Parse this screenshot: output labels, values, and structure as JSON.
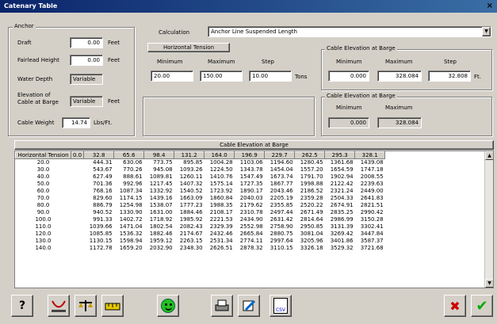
{
  "window": {
    "title": "Catenary Table",
    "close": "×"
  },
  "anchor": {
    "group": "Anchor",
    "draft_label": "Draft",
    "draft_value": "0.00",
    "draft_unit": "Feet",
    "fairlead_label": "Fairlead Height",
    "fairlead_value": "0.00",
    "fairlead_unit": "Feet",
    "water_label": "Water Depth",
    "water_value": "Variable",
    "elev_label1": "Elevation of",
    "elev_label2": "Cable at Barge",
    "elev_value": "Variable",
    "elev_unit": "Feet",
    "weight_label": "Cable Weight",
    "weight_value": "14.74",
    "weight_unit": "Lbs/Ft."
  },
  "calculation": {
    "label": "Calculation",
    "value": "Anchor Line Suspended Length"
  },
  "tension": {
    "button": "Horizontal Tension",
    "min_label": "Minimum",
    "max_label": "Maximum",
    "step_label": "Step",
    "min": "20.00",
    "max": "150.00",
    "step": "10.00",
    "unit": "Tons"
  },
  "elev1": {
    "group": "Cable Elevation at Barge",
    "min_label": "Minimum",
    "max_label": "Maximum",
    "step_label": "Step",
    "min": "0.000",
    "max": "328.084",
    "step": "32.808",
    "unit": "Ft."
  },
  "elev2": {
    "group": "Cable Elevation at Barge",
    "min_label": "Minimum",
    "max_label": "Maximum",
    "min": "0.000",
    "max": "328.084"
  },
  "table": {
    "caption": "Cable Elevation at Barge",
    "headers": [
      "Horizontal Tension",
      "0.0",
      "32.8",
      "65.6",
      "98.4",
      "131.2",
      "164.0",
      "196.9",
      "229.7",
      "262.5",
      "295.3",
      "328.1"
    ],
    "rows": [
      [
        "20.0",
        "",
        "444.31",
        "630.06",
        "773.75",
        "895.85",
        "1004.28",
        "1103.06",
        "1194.60",
        "1280.45",
        "1361.68",
        "1439.08"
      ],
      [
        "30.0",
        "",
        "543.67",
        "770.26",
        "945.08",
        "1093.26",
        "1224.50",
        "1343.78",
        "1454.04",
        "1557.20",
        "1654.59",
        "1747.18"
      ],
      [
        "40.0",
        "",
        "627.49",
        "888.61",
        "1089.81",
        "1260.11",
        "1410.76",
        "1547.49",
        "1673.74",
        "1791.70",
        "1902.94",
        "2008.55"
      ],
      [
        "50.0",
        "",
        "701.36",
        "992.96",
        "1217.45",
        "1407.32",
        "1575.14",
        "1727.35",
        "1867.77",
        "1998.88",
        "2122.42",
        "2239.63"
      ],
      [
        "60.0",
        "",
        "768.16",
        "1087.34",
        "1332.92",
        "1540.52",
        "1723.92",
        "1890.17",
        "2043.46",
        "2186.52",
        "2321.24",
        "2449.00"
      ],
      [
        "70.0",
        "",
        "829.60",
        "1174.15",
        "1439.16",
        "1663.09",
        "1860.84",
        "2040.03",
        "2205.19",
        "2359.28",
        "2504.33",
        "2641.83"
      ],
      [
        "80.0",
        "",
        "886.79",
        "1254.98",
        "1538.07",
        "1777.23",
        "1988.35",
        "2179.62",
        "2355.85",
        "2520.22",
        "2674.91",
        "2821.51"
      ],
      [
        "90.0",
        "",
        "940.52",
        "1330.90",
        "1631.00",
        "1884.46",
        "2108.17",
        "2310.78",
        "2497.44",
        "2671.49",
        "2835.25",
        "2990.42"
      ],
      [
        "100.0",
        "",
        "991.33",
        "1402.72",
        "1718.92",
        "1985.92",
        "2221.53",
        "2434.90",
        "2631.42",
        "2814.64",
        "2986.99",
        "3150.28"
      ],
      [
        "110.0",
        "",
        "1039.66",
        "1471.04",
        "1802.54",
        "2082.43",
        "2329.39",
        "2552.98",
        "2758.90",
        "2950.85",
        "3131.39",
        "3302.41"
      ],
      [
        "120.0",
        "",
        "1085.85",
        "1536.32",
        "1882.46",
        "2174.67",
        "2432.46",
        "2665.84",
        "2880.75",
        "3081.04",
        "3269.42",
        "3447.84"
      ],
      [
        "130.0",
        "",
        "1130.15",
        "1598.94",
        "1959.12",
        "2263.15",
        "2531.34",
        "2774.11",
        "2997.64",
        "3205.96",
        "3401.86",
        "3587.37"
      ],
      [
        "140.0",
        "",
        "1172.78",
        "1659.20",
        "2032.90",
        "2348.30",
        "2626.51",
        "2878.32",
        "3110.15",
        "3326.18",
        "3529.32",
        "3721.68"
      ]
    ]
  },
  "colors": {
    "titlebar": "#0a246a",
    "window": "#d4d0c8"
  },
  "toolbar": {
    "csv_label": "CSV"
  }
}
